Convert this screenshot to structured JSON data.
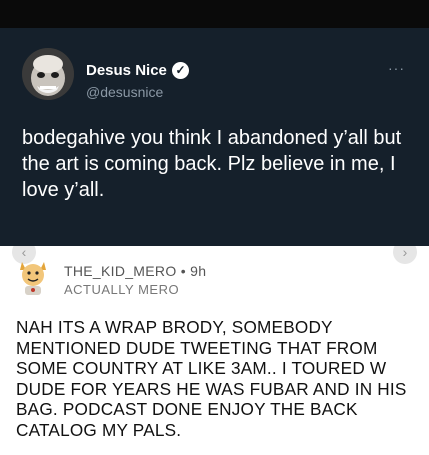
{
  "tweet": {
    "author_name": "Desus Nice",
    "author_handle": "@desusnice",
    "more_label": "···",
    "verified_glyph": "✓",
    "text": "bodegahive you think I abandoned y’all but the art is coming back. Plz believe in me, I love y’all.",
    "accent_color": "#15202b"
  },
  "reply": {
    "author": "THE_KID_MERO",
    "separator": " • ",
    "time": "9h",
    "flair": "ACTUALLY MERO",
    "text": "NAH ITS A WRAP BRODY, SOMEBODY MENTIONED DUDE TWEETING THAT FROM SOME COUNTRY AT LIKE 3AM.. I TOURED W DUDE FOR YEARS HE WAS FUBAR AND IN HIS BAG. PODCAST DONE ENJOY THE BACK CATALOG MY PALS."
  },
  "nav": {
    "prev_glyph": "‹",
    "next_glyph": "›"
  }
}
